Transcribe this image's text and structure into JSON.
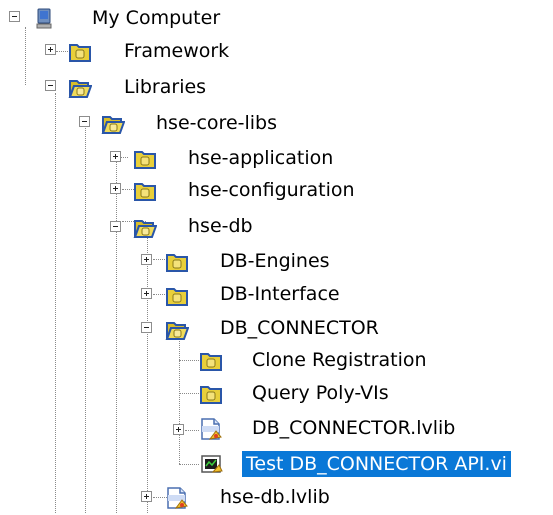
{
  "tree": {
    "nodes": [
      {
        "id": "my-computer",
        "label": "My Computer",
        "icon": "computer-icon",
        "expanded": true,
        "level": 0
      },
      {
        "id": "framework",
        "label": "Framework",
        "icon": "folder-icon",
        "expanded": false,
        "level": 1
      },
      {
        "id": "libraries",
        "label": "Libraries",
        "icon": "open-folder-icon",
        "expanded": true,
        "level": 1
      },
      {
        "id": "hse-core-libs",
        "label": "hse-core-libs",
        "icon": "open-folder-icon",
        "expanded": true,
        "level": 2
      },
      {
        "id": "hse-application",
        "label": "hse-application",
        "icon": "folder-icon",
        "expanded": false,
        "level": 3
      },
      {
        "id": "hse-configuration",
        "label": "hse-configuration",
        "icon": "folder-icon",
        "expanded": false,
        "level": 3
      },
      {
        "id": "hse-db",
        "label": "hse-db",
        "icon": "open-folder-icon",
        "expanded": true,
        "level": 3
      },
      {
        "id": "db-engines",
        "label": "DB-Engines",
        "icon": "folder-icon",
        "expanded": false,
        "level": 4
      },
      {
        "id": "db-interface",
        "label": "DB-Interface",
        "icon": "folder-icon",
        "expanded": false,
        "level": 4
      },
      {
        "id": "db-connector",
        "label": "DB_CONNECTOR",
        "icon": "open-folder-icon",
        "expanded": true,
        "level": 4
      },
      {
        "id": "clone-registration",
        "label": "Clone Registration",
        "icon": "folder-icon",
        "level": 5
      },
      {
        "id": "query-poly-vis",
        "label": "Query Poly-VIs",
        "icon": "folder-icon",
        "level": 5
      },
      {
        "id": "db-connector-lvlib",
        "label": "DB_CONNECTOR.lvlib",
        "icon": "library-file-icon",
        "expanded": false,
        "level": 5
      },
      {
        "id": "test-db-connector-api",
        "label": "Test DB_CONNECTOR API.vi",
        "icon": "vi-file-icon",
        "selected": true,
        "level": 5
      },
      {
        "id": "hse-db-lvlib",
        "label": "hse-db.lvlib",
        "icon": "library-file-icon",
        "expanded": false,
        "level": 4
      }
    ]
  },
  "colors": {
    "selection": "#0a78d7",
    "folder": "#e8cf3a",
    "folder_outline": "#2a56a8"
  }
}
